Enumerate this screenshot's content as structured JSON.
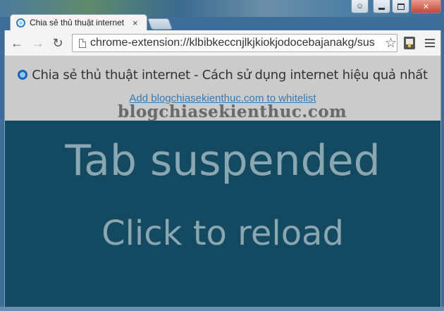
{
  "window": {
    "controls": [
      "user",
      "minimize",
      "maximize",
      "close"
    ]
  },
  "tab": {
    "title": "Chia sẻ thủ thuật internet",
    "close_glyph": "×"
  },
  "toolbar": {
    "back_glyph": "←",
    "forward_glyph": "→",
    "reload_glyph": "↻",
    "url": "chrome-extension://klbibkeccnjlkjkiokjodocebajanakg/sus",
    "star_glyph": "☆"
  },
  "page": {
    "heading": "Chia sẻ thủ thuật internet - Cách sử dụng internet hiệu quả nhất",
    "whitelist_link": "Add blogchiasekienthuc.com to whitelist",
    "watermark": "blogchiasekienthuc.com",
    "suspended_title": "Tab suspended",
    "reload_text": "Click to reload"
  },
  "colors": {
    "suspended_bg": "#134a62",
    "suspended_text": "#8aa6b1",
    "header_bg": "#cbcbcb",
    "link": "#3a7ab2",
    "close_button": "#c7463a"
  }
}
